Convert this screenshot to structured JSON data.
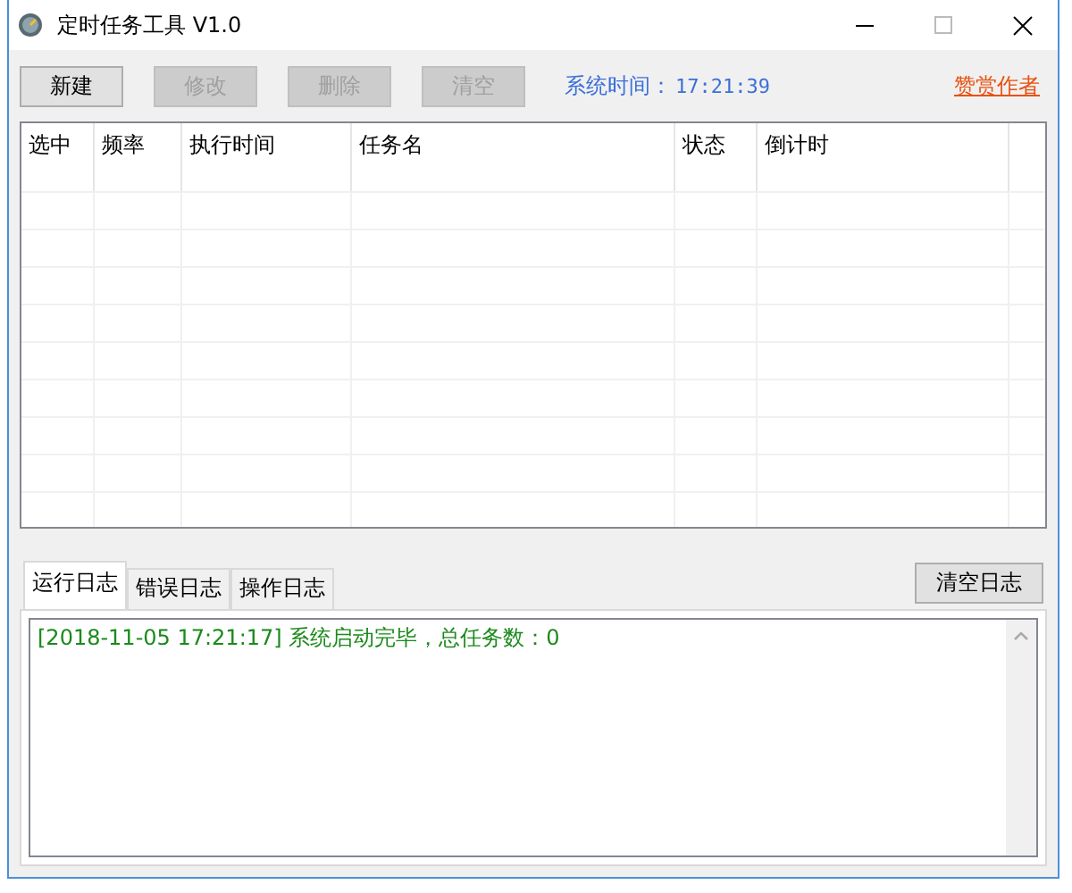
{
  "window": {
    "title": "定时任务工具 V1.0"
  },
  "toolbar": {
    "buttons": [
      {
        "label": "新建",
        "disabled": false
      },
      {
        "label": "修改",
        "disabled": true
      },
      {
        "label": "删除",
        "disabled": true
      },
      {
        "label": "清空",
        "disabled": true
      }
    ],
    "time_label": "系统时间：",
    "time_value": "17:21:39",
    "link": "赞赏作者"
  },
  "table": {
    "columns": [
      "选中",
      "频率",
      "执行时间",
      "任务名",
      "状态",
      "倒计时"
    ]
  },
  "log": {
    "tabs": [
      {
        "label": "运行日志",
        "selected": true
      },
      {
        "label": "错误日志",
        "selected": false
      },
      {
        "label": "操作日志",
        "selected": false
      }
    ],
    "clear_button": "清空日志",
    "lines": [
      "[2018-11-05 17:21:17] 系统启动完毕，总任务数：0"
    ]
  }
}
